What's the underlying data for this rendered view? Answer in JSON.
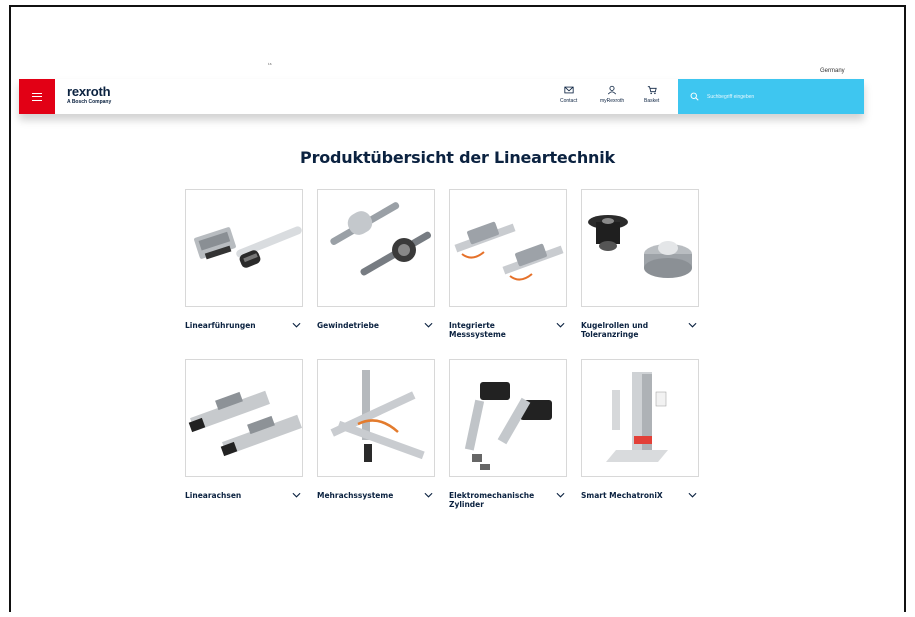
{
  "top": {
    "tiny_mark": "¹⁶",
    "country": "Germany"
  },
  "header": {
    "logo_word": "rexroth",
    "logo_sub": "A Bosch Company",
    "actions": [
      {
        "label": "Contact",
        "icon": "mail-icon"
      },
      {
        "label": "myRexroth",
        "icon": "user-icon"
      },
      {
        "label": "Basket",
        "icon": "basket-icon"
      }
    ],
    "search_placeholder": "Suchbegriff eingeben"
  },
  "colors": {
    "brand_red": "#e20015",
    "search_blue": "#3ec6f0",
    "navy": "#0b2240"
  },
  "page_title": "Produktübersicht der Lineartechnik",
  "cards": [
    {
      "label": "Linearführungen"
    },
    {
      "label": "Gewindetriebe"
    },
    {
      "label": "Integrierte Messsysteme"
    },
    {
      "label": "Kugelrollen und Toleranzringe"
    },
    {
      "label": "Linearachsen"
    },
    {
      "label": "Mehrachssysteme"
    },
    {
      "label": "Elektromechanische Zylinder"
    },
    {
      "label": "Smart MechatroniX"
    }
  ]
}
